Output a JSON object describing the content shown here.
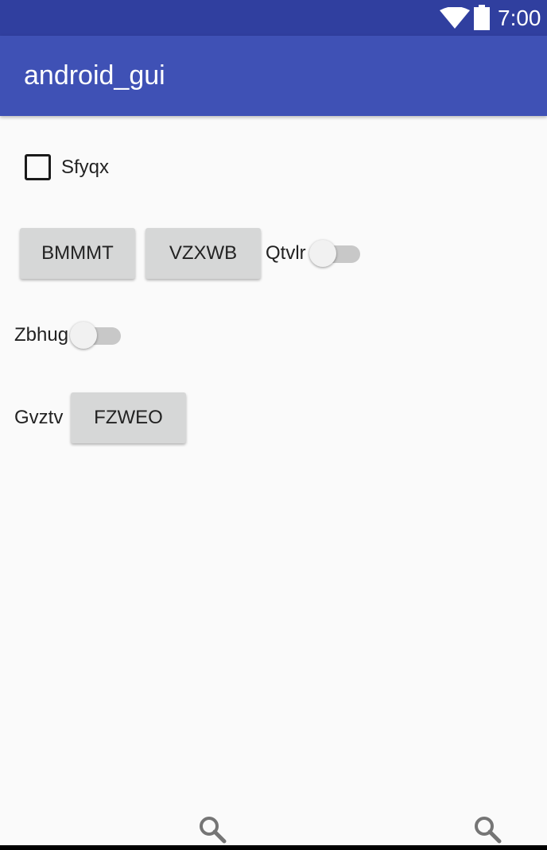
{
  "status_bar": {
    "time": "7:00",
    "icons": [
      "wifi-icon",
      "battery-icon"
    ]
  },
  "app_bar": {
    "title": "android_gui"
  },
  "checkbox": {
    "label": "Sfyqx",
    "checked": false
  },
  "buttons": {
    "bmmmt": "BMMMT",
    "vzxwb": "VZXWB",
    "fzweo": "FZWEO"
  },
  "switches": {
    "qtvlr": {
      "label": "Qtvlr",
      "on": false
    },
    "zbhug": {
      "label": "Zbhug",
      "on": false
    }
  },
  "labels": {
    "gvztv": "Gvztv"
  },
  "bottom_icons": [
    "search-icon",
    "search-icon"
  ],
  "colors": {
    "status_bar": "#303f9f",
    "app_bar": "#3f51b5",
    "background": "#fafafa",
    "button": "#d6d7d7"
  }
}
